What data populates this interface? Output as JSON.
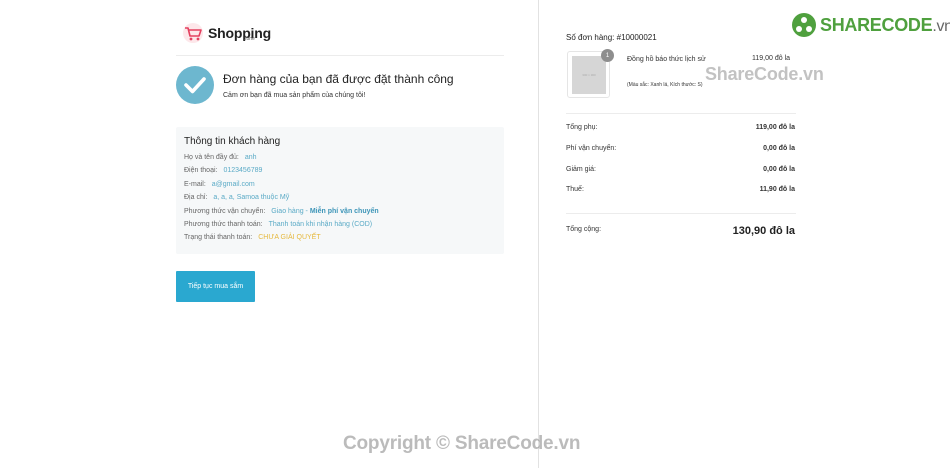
{
  "logo": {
    "name": "Shopping",
    "sub": "zone"
  },
  "success": {
    "title": "Đơn hàng của bạn đã được đặt thành công",
    "subtitle": "Cảm ơn bạn đã mua sản phẩm của chúng tôi!"
  },
  "customer": {
    "title": "Thông tin khách hàng",
    "rows": [
      {
        "label": "Họ và tên đầy đủ:",
        "value": "anh"
      },
      {
        "label": "Điện thoại:",
        "value": "0123456789"
      },
      {
        "label": "E-mail:",
        "value": "a@gmail.com"
      },
      {
        "label": "Địa chỉ:",
        "value": "a, a, a, Samoa thuộc Mỹ"
      },
      {
        "label": "Phương thức vận chuyển:",
        "value": "Giao hàng - ",
        "value_bold": "Miễn phí vận chuyển"
      },
      {
        "label": "Phương thức thanh toán:",
        "value": "Thanh toán khi nhận hàng (COD)"
      },
      {
        "label": "Trạng thái thanh toán:",
        "value": "CHƯA GIẢI QUYẾT"
      }
    ]
  },
  "continue_button": "Tiếp tục mua sắm",
  "order": {
    "number_label": "Số đơn hàng: #10000021",
    "item": {
      "quantity": "1",
      "image_placeholder": "300 × 300",
      "name": "Đồng hồ báo thức lịch sử",
      "variant": "(Màu sắc: Xanh lá, Kích thước: S)",
      "price": "119,00 đô la"
    },
    "summary": [
      {
        "label": "Tổng phụ:",
        "value": "119,00 đô la"
      },
      {
        "label": "Phí vận chuyển:",
        "value": "0,00 đô la"
      },
      {
        "label": "Giảm giá:",
        "value": "0,00 đô la"
      },
      {
        "label": "Thuế:",
        "value": "11,90 đô la"
      }
    ],
    "total": {
      "label": "Tổng cộng:",
      "value": "130,90 đô la"
    }
  },
  "watermarks": {
    "brand_main": "SHARECODE",
    "brand_suffix": ".vn",
    "right": "ShareCode.vn",
    "bottom": "Copyright © ShareCode.vn"
  },
  "colors": {
    "accent": "#2aa8d0",
    "check": "#6db7cf",
    "link_value": "#5aaac6",
    "pending": "#e6b93e",
    "brand_green": "#4fa03e"
  }
}
